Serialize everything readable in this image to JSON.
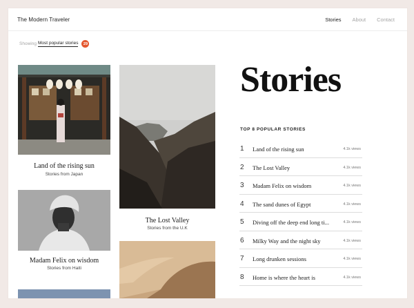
{
  "header": {
    "brand": "The Modern Traveler",
    "nav": [
      {
        "label": "Stories",
        "active": true
      },
      {
        "label": "About",
        "active": false
      },
      {
        "label": "Contact",
        "active": false
      }
    ]
  },
  "filter": {
    "prefix": "Showing",
    "selected": "Most popular stories",
    "count": "29"
  },
  "cards": [
    {
      "title": "Land of the rising sun",
      "subtitle": "Stories from Japan"
    },
    {
      "title": "The Lost Valley",
      "subtitle": "Stories from the U.K"
    },
    {
      "title": "Madam Felix on wisdom",
      "subtitle": "Stories from Haiti"
    }
  ],
  "main": {
    "title": "Stories",
    "list_heading": "TOP 8 POPULAR STORIES",
    "stories": [
      {
        "rank": "1",
        "title": "Land of the rising sun",
        "views": "4.1k views"
      },
      {
        "rank": "2",
        "title": "The Lost Valley",
        "views": "4.1k views"
      },
      {
        "rank": "3",
        "title": "Madam Felix on wisdom",
        "views": "4.1k views"
      },
      {
        "rank": "4",
        "title": "The sand dunes of Egypt",
        "views": "4.1k views"
      },
      {
        "rank": "5",
        "title": "Diving off the deep end long ti...",
        "views": "4.1k views"
      },
      {
        "rank": "6",
        "title": "Milky Way and the night sky",
        "views": "4.1k views"
      },
      {
        "rank": "7",
        "title": "Long drunken sessions",
        "views": "4.1k views"
      },
      {
        "rank": "8",
        "title": "Home is where the heart is",
        "views": "4.1k views"
      }
    ]
  },
  "colors": {
    "accent": "#e4572e",
    "background": "#f1e9e6"
  }
}
